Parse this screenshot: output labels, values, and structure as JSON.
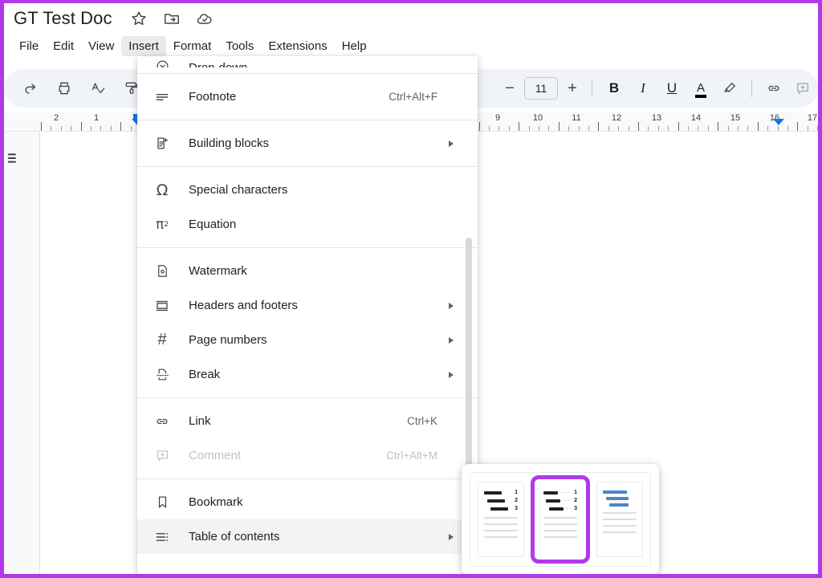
{
  "app": {
    "name": "Google Docs",
    "accent_color": "#1a73e8",
    "annotation_color": "#b13ae8"
  },
  "titlebar": {
    "doc_title": "GT Test Doc",
    "icons": [
      {
        "name": "star-icon",
        "label": "Star"
      },
      {
        "name": "move-folder-icon",
        "label": "Move"
      },
      {
        "name": "cloud-saved-icon",
        "label": "Saved to Drive"
      }
    ]
  },
  "menubar": {
    "items": [
      {
        "label": "File",
        "active": false
      },
      {
        "label": "Edit",
        "active": false
      },
      {
        "label": "View",
        "active": false
      },
      {
        "label": "Insert",
        "active": true
      },
      {
        "label": "Format",
        "active": false
      },
      {
        "label": "Tools",
        "active": false
      },
      {
        "label": "Extensions",
        "active": false
      },
      {
        "label": "Help",
        "active": false
      }
    ]
  },
  "toolbar": {
    "left_icons": [
      {
        "name": "redo-icon",
        "label": "Redo"
      },
      {
        "name": "print-icon",
        "label": "Print"
      },
      {
        "name": "spellcheck-icon",
        "label": "Spelling and grammar check"
      },
      {
        "name": "paint-format-icon",
        "label": "Paint format"
      }
    ],
    "font_size": "11",
    "decrease_label": "−",
    "increase_label": "+",
    "bold_label": "B",
    "italic_label": "I",
    "underline_label": "U",
    "text_color_label": "A",
    "right_icons": [
      {
        "name": "highlight-icon",
        "label": "Highlight color"
      },
      {
        "name": "link-icon",
        "label": "Insert link"
      },
      {
        "name": "comment-icon",
        "label": "Add comment"
      }
    ]
  },
  "ruler": {
    "left_numbers": [
      "2",
      "1"
    ],
    "right_numbers": [
      "9",
      "10",
      "11",
      "12",
      "13",
      "14",
      "15",
      "16",
      "17"
    ],
    "left_indent_position": "1",
    "right_indent_position": "16"
  },
  "document": {
    "outline_icon": "document-outline-icon",
    "page_content": ""
  },
  "insert_menu": {
    "items": [
      {
        "icon": "dropdown-icon",
        "label": "Drop-down",
        "accel": "",
        "arrow": false,
        "disabled": false,
        "clipped": true,
        "highlight": false
      },
      {
        "sep": true
      },
      {
        "icon": "footnote-icon",
        "label": "Footnote",
        "accel": "Ctrl+Alt+F",
        "arrow": false,
        "disabled": false,
        "highlight": false
      },
      {
        "sep": true
      },
      {
        "icon": "building-blocks-icon",
        "label": "Building blocks",
        "accel": "",
        "arrow": true,
        "disabled": false,
        "highlight": false
      },
      {
        "sep": true
      },
      {
        "icon": "omega-icon",
        "label": "Special characters",
        "accel": "",
        "arrow": false,
        "disabled": false,
        "highlight": false
      },
      {
        "icon": "equation-icon",
        "label": "Equation",
        "accel": "",
        "arrow": false,
        "disabled": false,
        "highlight": false
      },
      {
        "sep": true
      },
      {
        "icon": "watermark-icon",
        "label": "Watermark",
        "accel": "",
        "arrow": false,
        "disabled": false,
        "highlight": false
      },
      {
        "icon": "headers-footers-icon",
        "label": "Headers and footers",
        "accel": "",
        "arrow": true,
        "disabled": false,
        "highlight": false
      },
      {
        "icon": "page-numbers-icon",
        "label": "Page numbers",
        "accel": "",
        "arrow": true,
        "disabled": false,
        "highlight": false
      },
      {
        "icon": "break-icon",
        "label": "Break",
        "accel": "",
        "arrow": true,
        "disabled": false,
        "highlight": false
      },
      {
        "sep": true
      },
      {
        "icon": "link-icon",
        "label": "Link",
        "accel": "Ctrl+K",
        "arrow": false,
        "disabled": false,
        "highlight": false
      },
      {
        "icon": "comment-icon",
        "label": "Comment",
        "accel": "Ctrl+Alt+M",
        "arrow": false,
        "disabled": true,
        "highlight": false
      },
      {
        "sep": true
      },
      {
        "icon": "bookmark-icon",
        "label": "Bookmark",
        "accel": "",
        "arrow": false,
        "disabled": false,
        "highlight": false
      },
      {
        "icon": "table-of-contents-icon",
        "label": "Table of contents",
        "accel": "",
        "arrow": true,
        "disabled": false,
        "highlight": true
      }
    ],
    "scrollbar_visible": true
  },
  "toc_submenu": {
    "options": [
      {
        "name": "toc-with-page-numbers",
        "style": "numbered",
        "numbers": [
          "1",
          "2",
          "3"
        ],
        "dots": false,
        "selected": false,
        "color": "#202124"
      },
      {
        "name": "toc-with-dotted-leaders",
        "style": "dotted",
        "numbers": [
          "1",
          "2",
          "3"
        ],
        "dots": true,
        "selected": true,
        "color": "#202124"
      },
      {
        "name": "toc-with-links",
        "style": "links",
        "numbers": [],
        "dots": false,
        "selected": false,
        "color": "#4a86c8"
      }
    ]
  }
}
